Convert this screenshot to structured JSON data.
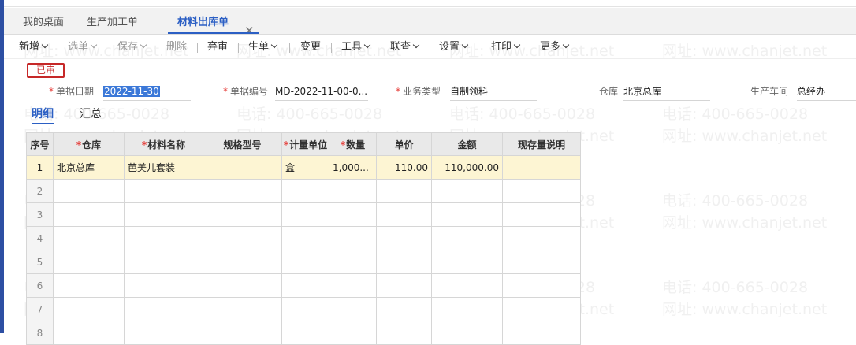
{
  "tabs": [
    {
      "label": "我的桌面"
    },
    {
      "label": "生产加工单"
    },
    {
      "label": "材料出库单"
    }
  ],
  "toolbar": {
    "items": [
      {
        "label": "新增",
        "chevron": true,
        "disabled": false
      },
      {
        "label": "选单",
        "chevron": true,
        "disabled": true
      },
      {
        "label": "保存",
        "chevron": true,
        "disabled": true
      },
      {
        "label": "删除",
        "chevron": false,
        "disabled": true
      },
      {
        "label": "弃审",
        "chevron": false,
        "disabled": false
      },
      {
        "label": "生单",
        "chevron": true,
        "disabled": false
      },
      {
        "label": "变更",
        "chevron": false,
        "disabled": false
      },
      {
        "label": "工具",
        "chevron": true,
        "disabled": false
      },
      {
        "label": "联查",
        "chevron": true,
        "disabled": false
      },
      {
        "label": "设置",
        "chevron": true,
        "disabled": false
      },
      {
        "label": "打印",
        "chevron": true,
        "disabled": false
      },
      {
        "label": "更多",
        "chevron": true,
        "disabled": false
      }
    ]
  },
  "status_badge": "已审",
  "form": {
    "date_label": "单据日期",
    "date_value": "2022-11-30",
    "code_label": "单据编号",
    "code_value": "MD-2022-11-00-0...",
    "biz_label": "业务类型",
    "biz_value": "自制领料",
    "warehouse_label": "仓库",
    "warehouse_value": "北京总库",
    "workshop_label": "生产车间",
    "workshop_value": "总经办"
  },
  "subtabs": [
    {
      "label": "明细"
    },
    {
      "label": "汇总"
    }
  ],
  "grid": {
    "columns": [
      {
        "label": "序号",
        "required": false
      },
      {
        "label": "仓库",
        "required": true
      },
      {
        "label": "材料名称",
        "required": true
      },
      {
        "label": "规格型号",
        "required": false
      },
      {
        "label": "计量单位",
        "required": true
      },
      {
        "label": "数量",
        "required": true
      },
      {
        "label": "单价",
        "required": false
      },
      {
        "label": "金额",
        "required": false
      },
      {
        "label": "现存量说明",
        "required": false
      }
    ],
    "rows": [
      [
        "1",
        "北京总库",
        "芭美儿套装",
        "",
        "盒",
        "1,000...",
        "110.00",
        "110,000.00",
        ""
      ],
      [
        "2",
        "",
        "",
        "",
        "",
        "",
        "",
        "",
        ""
      ],
      [
        "3",
        "",
        "",
        "",
        "",
        "",
        "",
        "",
        ""
      ],
      [
        "4",
        "",
        "",
        "",
        "",
        "",
        "",
        "",
        ""
      ],
      [
        "5",
        "",
        "",
        "",
        "",
        "",
        "",
        "",
        ""
      ],
      [
        "6",
        "",
        "",
        "",
        "",
        "",
        "",
        "",
        ""
      ],
      [
        "7",
        "",
        "",
        "",
        "",
        "",
        "",
        "",
        ""
      ],
      [
        "8",
        "",
        "",
        "",
        "",
        "",
        "",
        "",
        ""
      ]
    ]
  },
  "watermark": {
    "phone": "电话: 400-665-0028",
    "site": "网址: www.chanjet.net"
  },
  "colors": {
    "accent": "#2b5fc4",
    "status": "#c62828",
    "selected_row": "#fdf5d3",
    "left_bar": "#2d4fa3"
  }
}
